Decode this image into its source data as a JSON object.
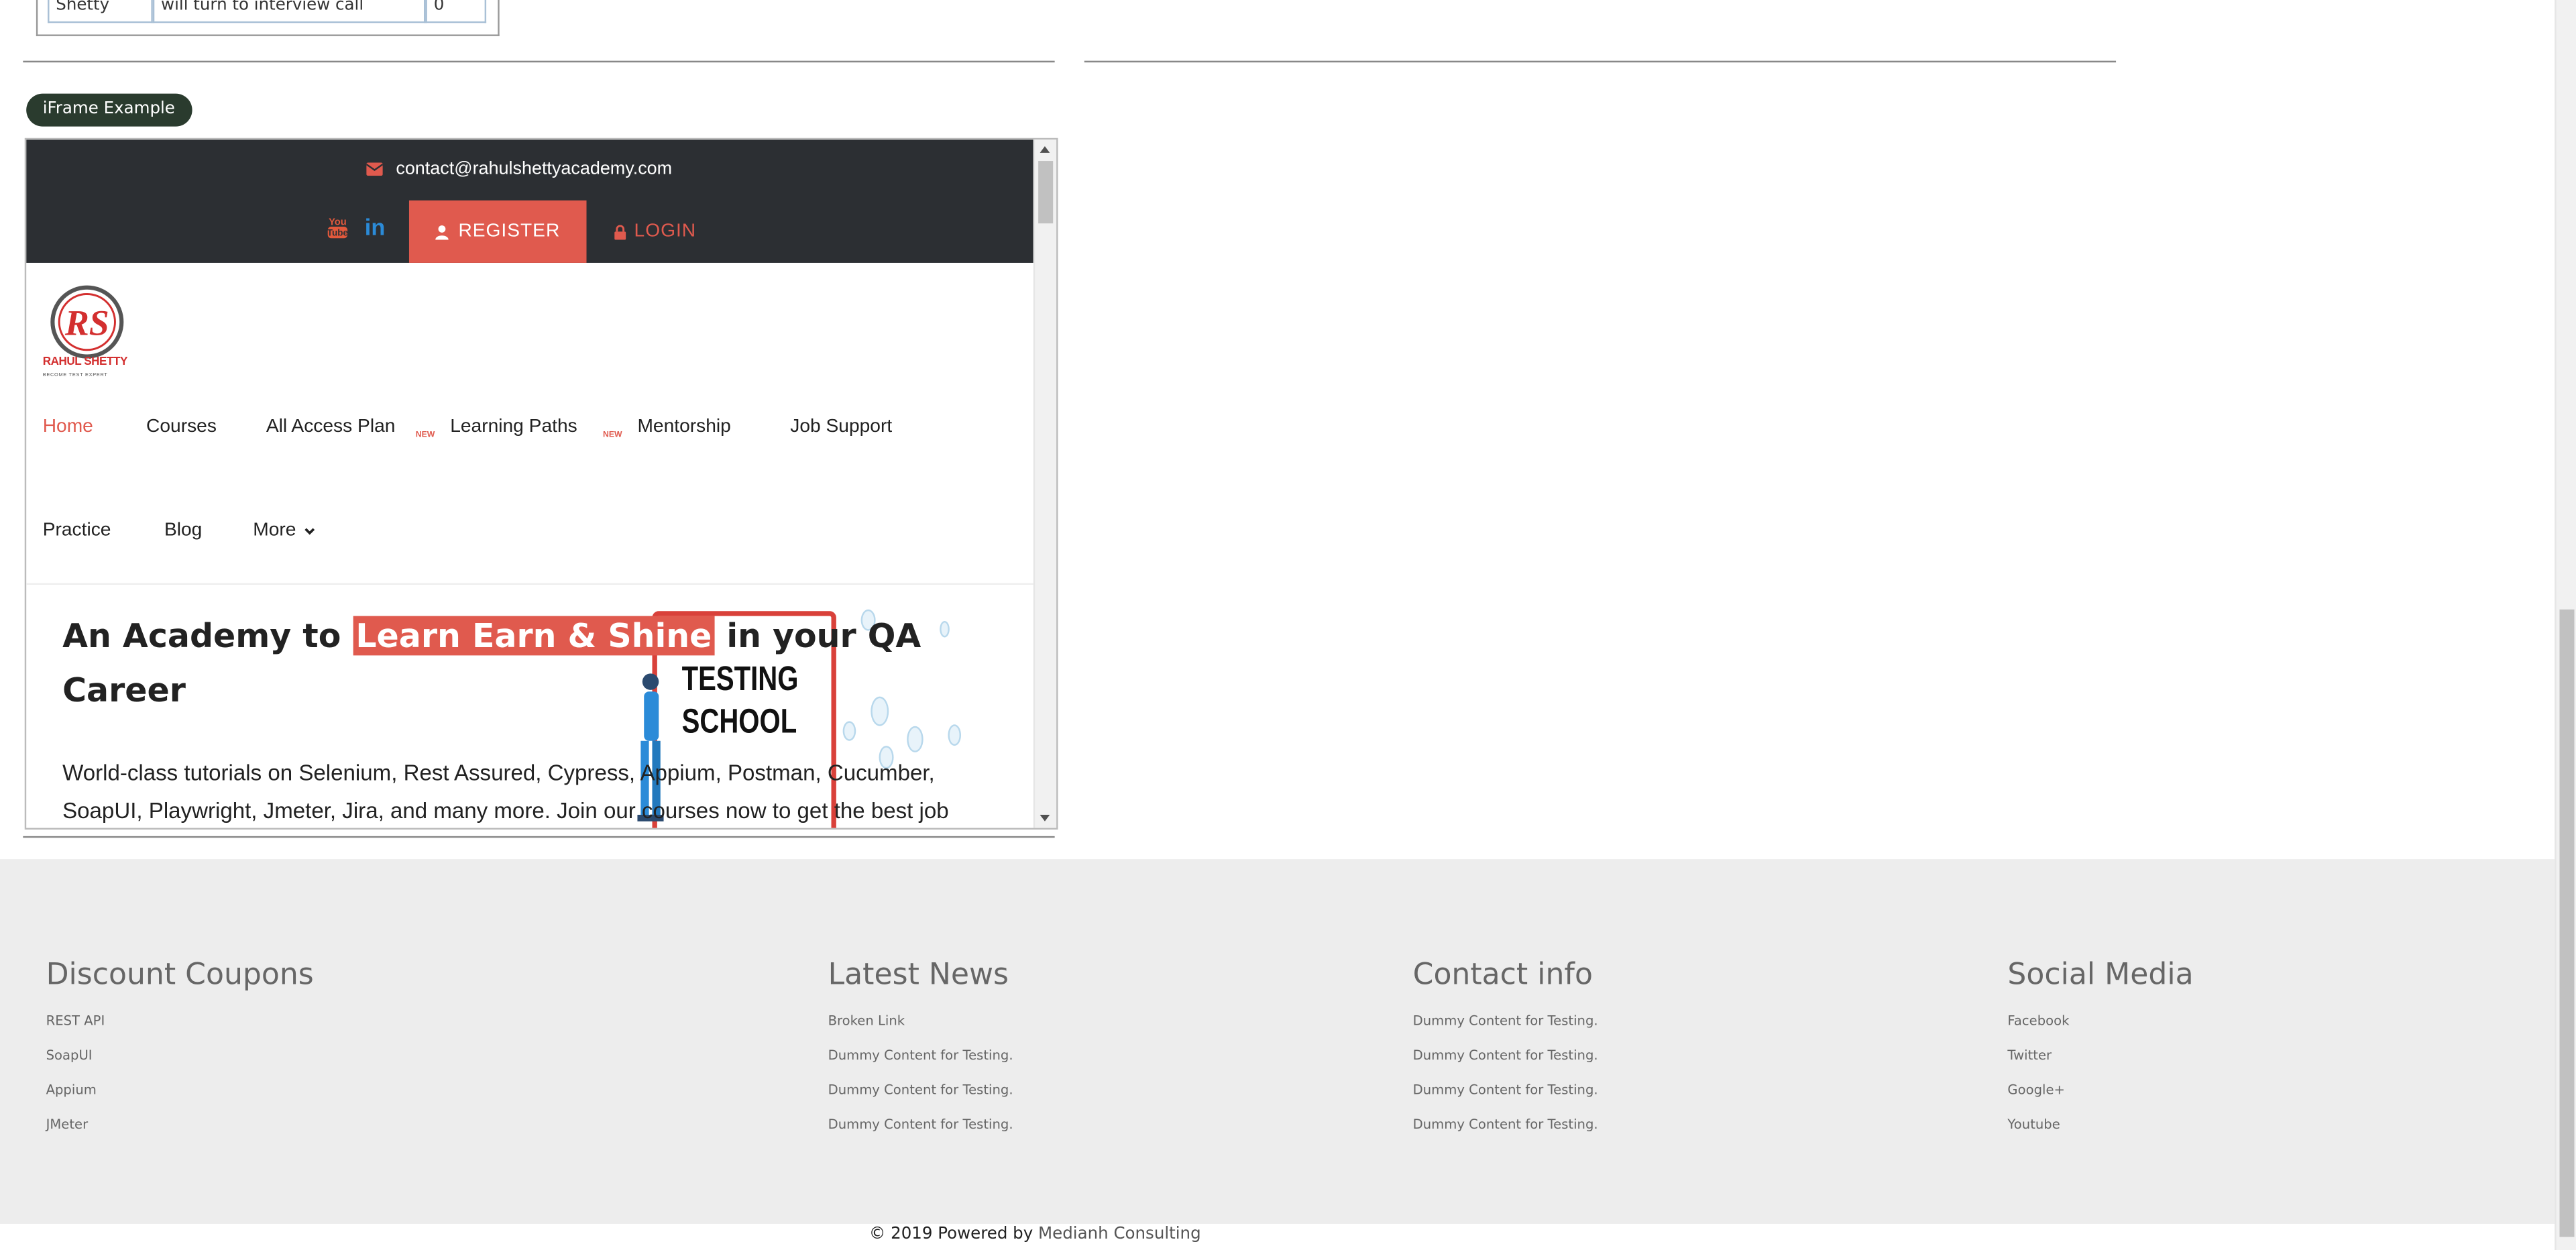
{
  "table_fragment": {
    "name_cell": "Shetty",
    "message_cell": "will turn to interview call",
    "amount_cell": "0"
  },
  "iframe_section": {
    "legend": "iFrame Example"
  },
  "embedded_site": {
    "contact_email": "contact@rahulshettyacademy.com",
    "social": {
      "youtube_icon": "youtube-icon",
      "youtube_text": "You\nTube",
      "linkedin_icon": "linkedin-icon",
      "linkedin_text": "in"
    },
    "register_label": "REGISTER",
    "login_label": "LOGIN",
    "logo": {
      "monogram": "RS",
      "brand": "RAHUL SHETTY",
      "tagline": "BECOME TEST EXPERT"
    },
    "nav": {
      "items": [
        {
          "label": "Home",
          "active": true
        },
        {
          "label": "Courses"
        },
        {
          "label": "All Access Plan",
          "badge": "NEW"
        },
        {
          "label": "Learning Paths",
          "badge": "NEW"
        },
        {
          "label": "Mentorship"
        },
        {
          "label": "Job Support"
        },
        {
          "label": "Practice"
        },
        {
          "label": "Blog"
        },
        {
          "label": "More"
        }
      ]
    },
    "hero": {
      "prefix": "An Academy to ",
      "highlight": "Learn Earn & Shine",
      "suffix": "  in your QA Career",
      "description": "World-class tutorials on Selenium, Rest Assured, Cypress, Appium, Postman, Cucumber, SoapUI, Playwright, Jmeter, Jira, and many more. Join our courses now to get the best job",
      "illustration_text_1": "TESTING",
      "illustration_text_2": "SCHOOL"
    }
  },
  "footer": {
    "columns": [
      {
        "heading": "Discount Coupons",
        "links": [
          "REST API",
          "SoapUI",
          "Appium",
          "JMeter"
        ]
      },
      {
        "heading": "Latest News",
        "links": [
          "Broken Link",
          "Dummy Content for Testing.",
          "Dummy Content for Testing.",
          "Dummy Content for Testing."
        ]
      },
      {
        "heading": "Contact info",
        "links": [
          "Dummy Content for Testing.",
          "Dummy Content for Testing.",
          "Dummy Content for Testing.",
          "Dummy Content for Testing."
        ]
      },
      {
        "heading": "Social Media",
        "links": [
          "Facebook",
          "Twitter",
          "Google+",
          "Youtube"
        ]
      }
    ],
    "copyright_prefix": "© 2019 Powered by ",
    "copyright_brand": "Medianh Consulting"
  },
  "colors": {
    "accent": "#e05a4e",
    "topbar": "#2c2f33",
    "footer_bg": "#ededed",
    "legend_bg": "#2a3b2e"
  }
}
